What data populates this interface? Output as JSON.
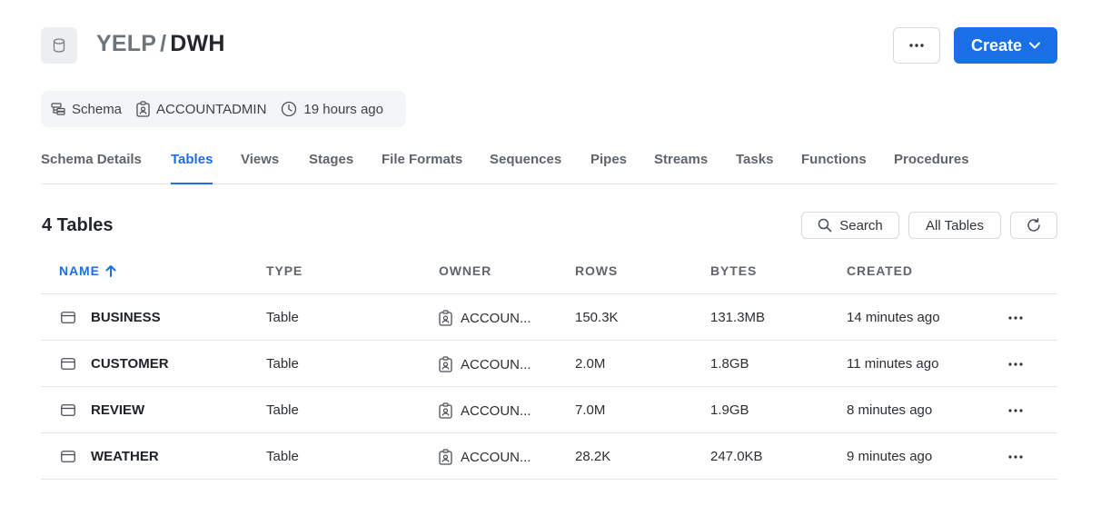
{
  "header": {
    "database": "YELP",
    "separator": "/",
    "schema": "DWH",
    "create_label": "Create"
  },
  "meta": {
    "type": "Schema",
    "owner": "ACCOUNTADMIN",
    "updated": "19 hours ago"
  },
  "tabs": [
    {
      "label": "Schema Details"
    },
    {
      "label": "Tables",
      "active": true
    },
    {
      "label": "Views"
    },
    {
      "label": "Stages"
    },
    {
      "label": "File Formats"
    },
    {
      "label": "Sequences"
    },
    {
      "label": "Pipes"
    },
    {
      "label": "Streams"
    },
    {
      "label": "Tasks"
    },
    {
      "label": "Functions"
    },
    {
      "label": "Procedures"
    }
  ],
  "section": {
    "count_label": "4 Tables",
    "search_label": "Search",
    "filter_label": "All Tables"
  },
  "table": {
    "columns": [
      "NAME",
      "TYPE",
      "OWNER",
      "ROWS",
      "BYTES",
      "CREATED"
    ],
    "sorted_column": "NAME",
    "sort_direction": "ascending",
    "rows": [
      {
        "name": "BUSINESS",
        "type": "Table",
        "owner": "ACCOUN...",
        "rows": "150.3K",
        "bytes": "131.3MB",
        "created": "14 minutes ago"
      },
      {
        "name": "CUSTOMER",
        "type": "Table",
        "owner": "ACCOUN...",
        "rows": "2.0M",
        "bytes": "1.8GB",
        "created": "11 minutes ago"
      },
      {
        "name": "REVIEW",
        "type": "Table",
        "owner": "ACCOUN...",
        "rows": "7.0M",
        "bytes": "1.9GB",
        "created": "8 minutes ago"
      },
      {
        "name": "WEATHER",
        "type": "Table",
        "owner": "ACCOUN...",
        "rows": "28.2K",
        "bytes": "247.0KB",
        "created": "9 minutes ago"
      }
    ]
  },
  "colors": {
    "accent": "#1a6ee6",
    "border": "#e3e6e9",
    "muted_text": "#5f656b"
  }
}
